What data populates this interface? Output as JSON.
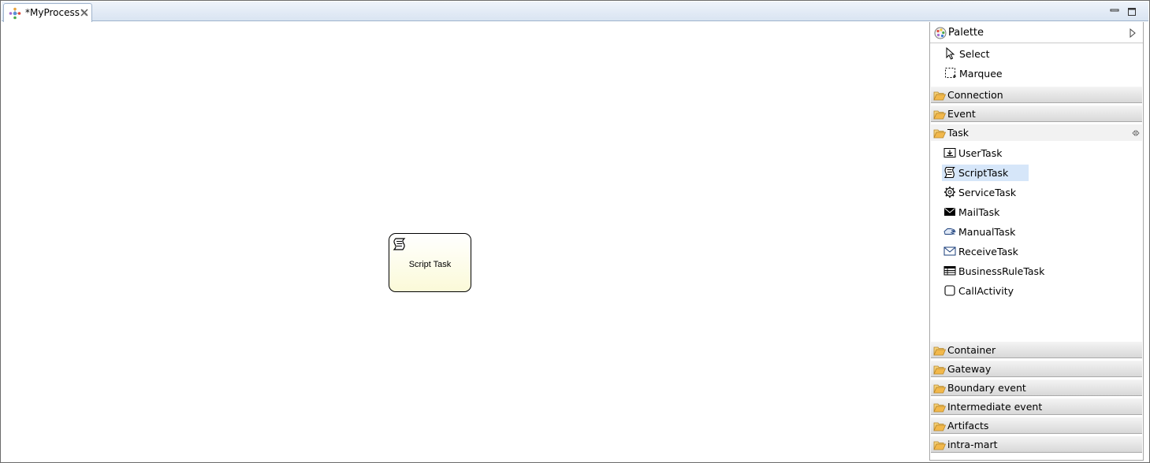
{
  "editor_tab": {
    "title": "*MyProcess"
  },
  "canvas": {
    "script_task": {
      "label": "Script Task"
    }
  },
  "palette": {
    "title": "Palette",
    "tools": [
      {
        "label": "Select",
        "icon": "arrow-pointer-icon"
      },
      {
        "label": "Marquee",
        "icon": "marquee-icon"
      }
    ],
    "drawers": {
      "connection": "Connection",
      "event": "Event",
      "task": "Task",
      "container": "Container",
      "gateway": "Gateway",
      "boundary_event": "Boundary event",
      "intermediate_event": "Intermediate event",
      "artifacts": "Artifacts",
      "intra_mart": "intra-mart"
    },
    "task_items": [
      {
        "label": "UserTask",
        "icon": "user-task-icon"
      },
      {
        "label": "ScriptTask",
        "icon": "script-icon",
        "selected": true
      },
      {
        "label": "ServiceTask",
        "icon": "gear-icon"
      },
      {
        "label": "MailTask",
        "icon": "mail-icon"
      },
      {
        "label": "ManualTask",
        "icon": "hand-icon"
      },
      {
        "label": "ReceiveTask",
        "icon": "envelope-icon"
      },
      {
        "label": "BusinessRuleTask",
        "icon": "table-icon"
      },
      {
        "label": "CallActivity",
        "icon": "call-activity-icon"
      }
    ]
  },
  "colors": {
    "tab_strip": "#d9e4f2",
    "task_fill": "#fbfad8",
    "selection": "#d6e6f9",
    "folder": "#f2b84b"
  }
}
